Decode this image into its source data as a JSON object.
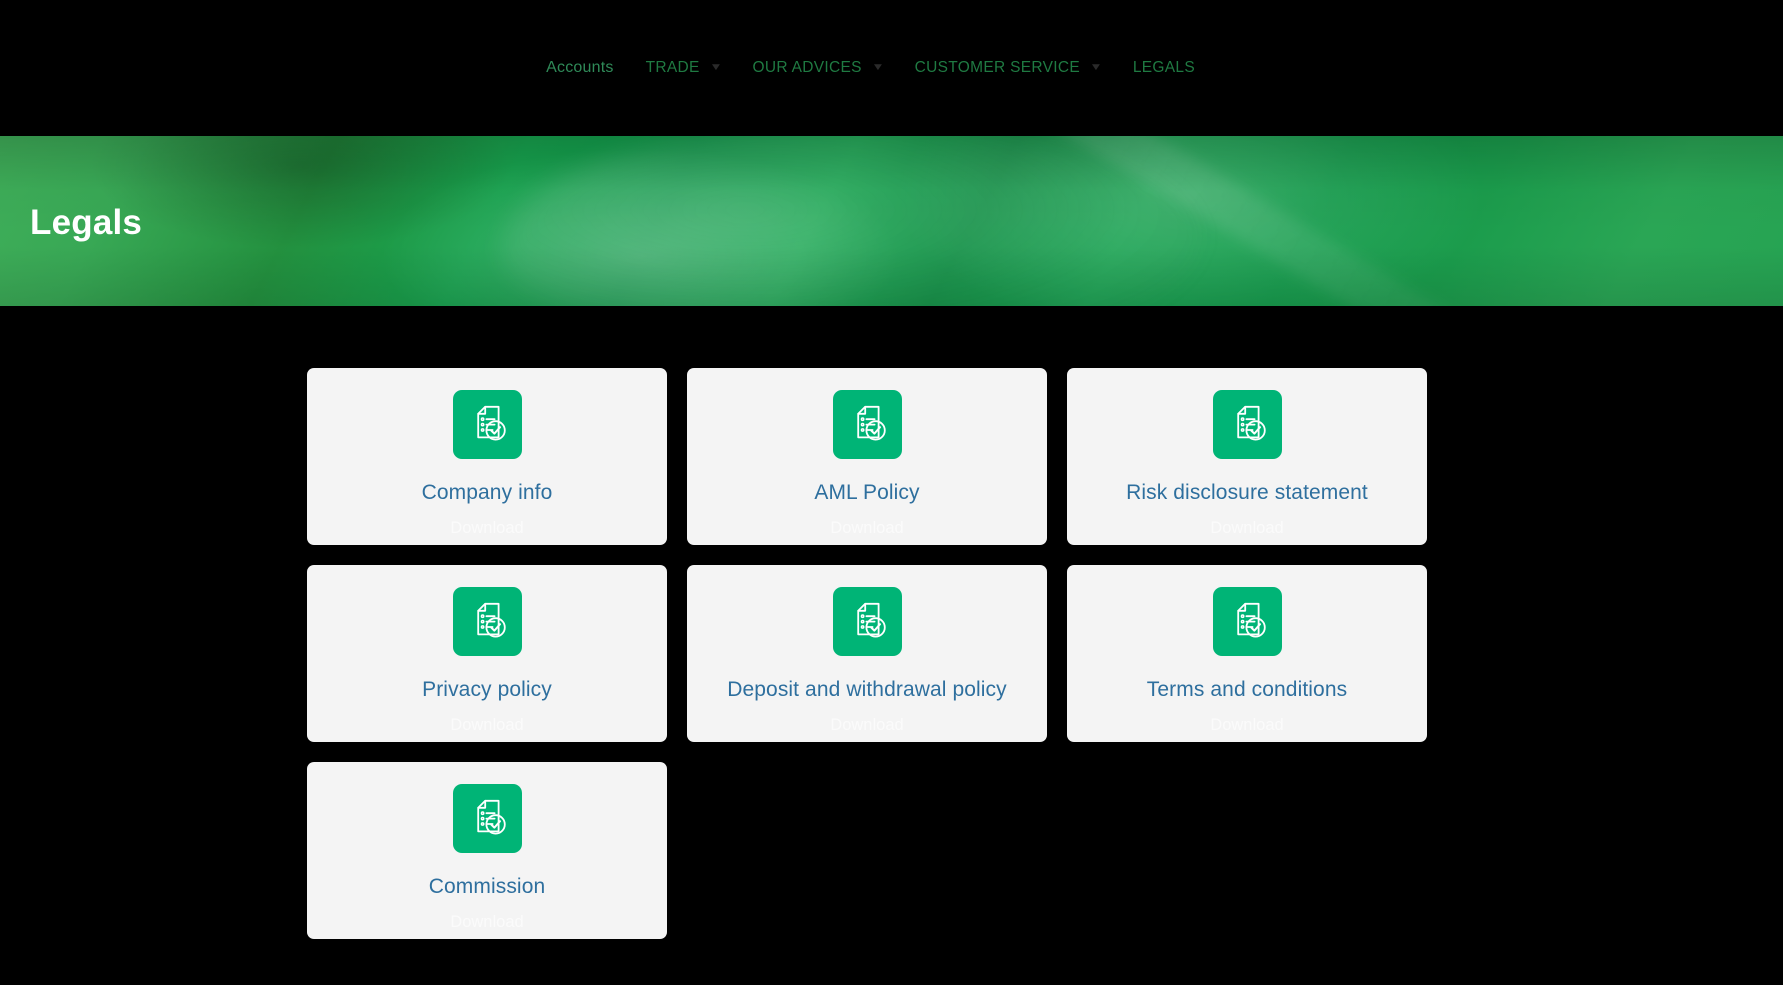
{
  "nav": {
    "items": [
      {
        "label": "Accounts",
        "has_dropdown": false,
        "caret": "▼",
        "variant": "accounts"
      },
      {
        "label": "TRADE",
        "has_dropdown": true,
        "caret": "▼",
        "variant": "normal"
      },
      {
        "label": "OUR ADVICES",
        "has_dropdown": true,
        "caret": "▼",
        "variant": "normal"
      },
      {
        "label": "CUSTOMER SERVICE",
        "has_dropdown": true,
        "caret": "▼",
        "variant": "normal"
      },
      {
        "label": "LEGALS",
        "has_dropdown": false,
        "caret": "▼",
        "variant": "normal"
      }
    ]
  },
  "hero": {
    "title": "Legals",
    "background_image": "hand-writing-with-pen-photo",
    "overlay_color": "#1f9b4b"
  },
  "cards": [
    {
      "title": "Company info",
      "action": "Download",
      "icon": "document-check-icon"
    },
    {
      "title": "AML Policy",
      "action": "Download",
      "icon": "document-check-icon"
    },
    {
      "title": "Risk disclosure statement",
      "action": "Download",
      "icon": "document-check-icon"
    },
    {
      "title": "Privacy policy",
      "action": "Download",
      "icon": "document-check-icon"
    },
    {
      "title": "Deposit and withdrawal policy",
      "action": "Download",
      "icon": "document-check-icon"
    },
    {
      "title": "Terms and conditions",
      "action": "Download",
      "icon": "document-check-icon"
    },
    {
      "title": "Commission",
      "action": "Download",
      "icon": "document-check-icon"
    }
  ],
  "colors": {
    "page_background": "#000000",
    "card_background": "#f4f4f4",
    "icon_tile_green": "#00b476",
    "card_title_blue": "#2e6f9e",
    "download_text": "#fbfbfb",
    "nav_green": "#1f7a42",
    "hero_green": "#2aa84f"
  }
}
